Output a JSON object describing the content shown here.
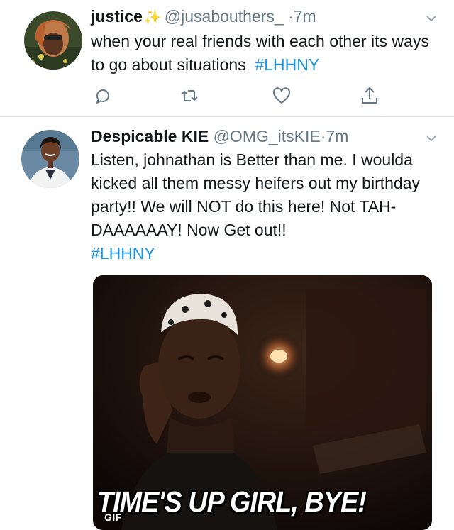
{
  "tweets": [
    {
      "display_name": "justice",
      "name_emoji": "✨",
      "handle": "@jusabouthers_",
      "separator": "·",
      "time": "7m",
      "text": "when your real friends with each other its ways to go about situations",
      "hashtag": "#LHHNY",
      "actions": [
        "reply-icon",
        "retweet-icon",
        "like-icon",
        "share-icon"
      ]
    },
    {
      "display_name": "Despicable KIE",
      "handle": "@OMG_itsKIE",
      "separator": "·",
      "time": "7m",
      "text": "Listen, johnathan is Better than me. I woulda kicked all them messy heifers out my birthday party!! We will NOT do this here! Not TAH-DAAAAAAY! Now Get out!!",
      "hashtag": "#LHHNY",
      "media": {
        "caption": "TIME'S UP GIRL, BYE!",
        "badge": "GIF"
      }
    }
  ],
  "colors": {
    "hashtag": "#1b95e0",
    "secondary_text": "#657786",
    "divider": "#e1e8ed"
  }
}
